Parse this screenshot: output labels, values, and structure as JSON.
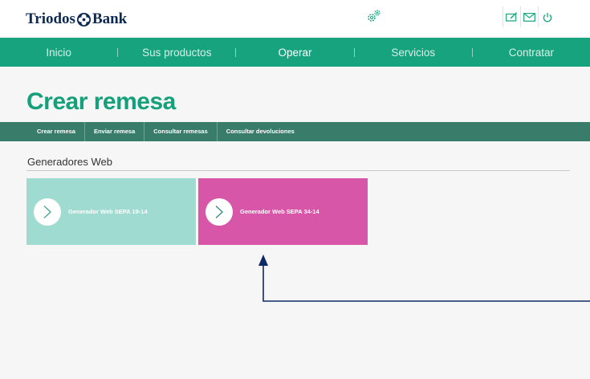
{
  "brand": {
    "name_left": "Triodos",
    "name_right": "Bank",
    "logo_color": "#0b2a55"
  },
  "header": {
    "settings_icon": "gears-icon",
    "icons": [
      "signature-icon",
      "mail-icon",
      "power-icon"
    ]
  },
  "nav": {
    "items": [
      {
        "label": "Inicio",
        "active": false
      },
      {
        "label": "Sus productos",
        "active": false
      },
      {
        "label": "Operar",
        "active": true
      },
      {
        "label": "Servicios",
        "active": false
      },
      {
        "label": "Contratar",
        "active": false
      }
    ],
    "color": "#17a37e"
  },
  "page": {
    "title": "Crear remesa"
  },
  "subnav": {
    "items": [
      {
        "label": "Crear remesa"
      },
      {
        "label": "Enviar remesa"
      },
      {
        "label": "Consultar remesas"
      },
      {
        "label": "Consultar devoluciones"
      }
    ],
    "color": "#3a7c6a"
  },
  "section": {
    "heading": "Generadores Web"
  },
  "tiles": [
    {
      "label": "Generador Web SEPA 19-14",
      "color": "#9fdbd0"
    },
    {
      "label": "Generador Web SEPA 34-14",
      "color": "#d856a8"
    }
  ],
  "annotation": {
    "color": "#0d2a66"
  }
}
